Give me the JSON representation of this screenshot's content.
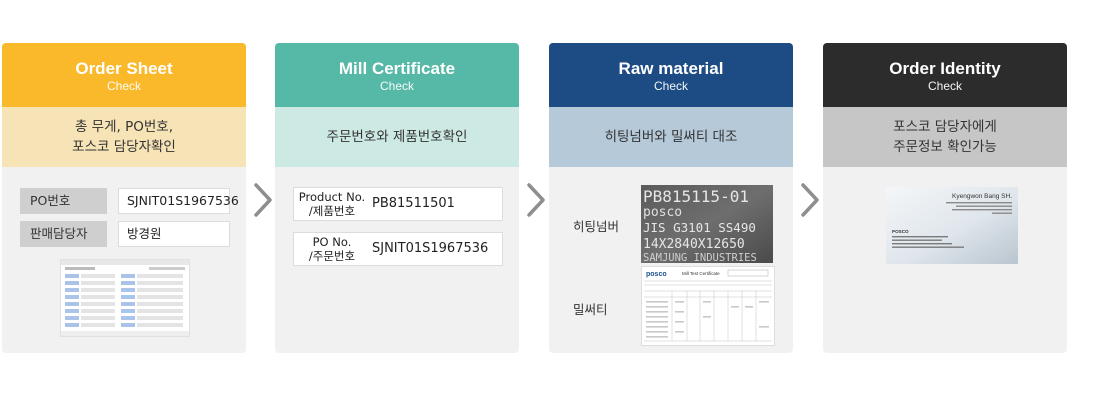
{
  "colors": {
    "card1_head": "#f9b92b",
    "card1_desc": "#f6e3b6",
    "card2_head": "#56b8a6",
    "card2_desc": "#cde9e4",
    "card3_head": "#1c4c83",
    "card3_desc": "#b6c9d9",
    "card4_head": "#2c2c2c",
    "card4_desc": "#c6c6c6",
    "card_body": "#f1f1f1",
    "arrow": "#8e8e8e"
  },
  "cards": [
    {
      "title": "Order Sheet",
      "subtitle": "Check",
      "description": "총 무게, PO번호,\n포스코 담당자확인",
      "rows": [
        {
          "label": "PO번호",
          "value": "SJNIT01S1967536"
        },
        {
          "label": "판매담당자",
          "value": "방경원"
        }
      ]
    },
    {
      "title": "Mill Certificate",
      "subtitle": "Check",
      "description": "주문번호와 제품번호확인",
      "rows": [
        {
          "label": "Product No.\n/제품번호",
          "value": "PB81511501"
        },
        {
          "label": "PO No.\n/주문번호",
          "value": "SJNIT01S1967536"
        }
      ]
    },
    {
      "title": "Raw material",
      "subtitle": "Check",
      "description": "히팅넘버와 밀써티 대조",
      "labels": [
        "히팅넘버",
        "밀써티"
      ],
      "steel_lines": [
        "PB815115-01",
        "posco",
        "JIS G3101 SS490",
        "14X2840X12650",
        "SAMJUNG INDUSTRIES"
      ],
      "mill_logo": "posco",
      "mill_title": "Mill Test Certificate"
    },
    {
      "title": "Order Identity",
      "subtitle": "Check",
      "description": "포스코 담당자에게\n주문정보 확인가능",
      "business_card": {
        "name": "Kyengwon Bang SH.",
        "company": "POSCO"
      }
    }
  ]
}
